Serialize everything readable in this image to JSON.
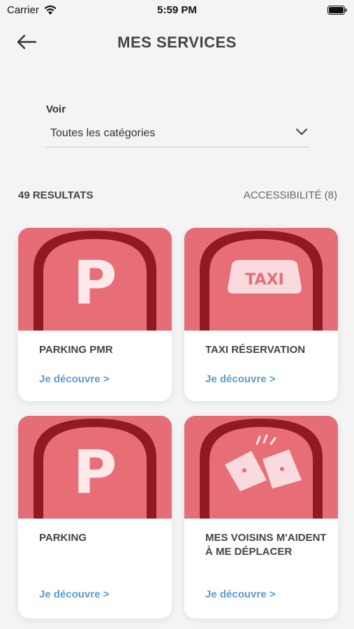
{
  "status_bar": {
    "carrier": "Carrier",
    "time": "5:59 PM"
  },
  "header": {
    "title": "MES SERVICES"
  },
  "filter": {
    "label": "Voir",
    "selected": "Toutes les catégories"
  },
  "results": {
    "count_label": "49 RESULTATS",
    "active_filter": "ACCESSIBILITÉ (8)"
  },
  "cards": [
    {
      "title": "PARKING PMR",
      "link": "Je découvre >",
      "icon": "parking-icon"
    },
    {
      "title": "TAXI RÉSERVATION",
      "link": "Je découvre >",
      "icon": "taxi-icon"
    },
    {
      "title": "PARKING",
      "link": "Je découvre >",
      "icon": "parking-icon"
    },
    {
      "title": "MES VOISINS M'AIDENT À ME DÉPLACER",
      "link": "Je découvre >",
      "icon": "neighbors-icon"
    }
  ],
  "colors": {
    "card_image": "#e56d78",
    "link": "#5b9bd1",
    "background": "#f4f4f4"
  }
}
